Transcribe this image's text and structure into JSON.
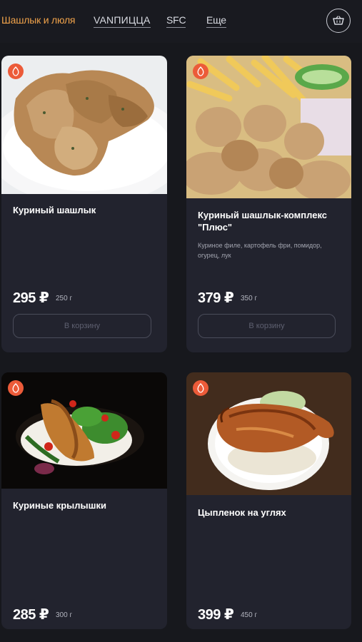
{
  "nav": {
    "items": [
      {
        "label": "Шашлык и люля"
      },
      {
        "label": "VANПИЦЦА"
      },
      {
        "label": "SFC"
      },
      {
        "label": "Еще"
      }
    ],
    "cart_icon": "basket-icon"
  },
  "products": [
    {
      "title": "Куриный шашлык",
      "description": "",
      "price": "295 ₽",
      "weight": "250 г",
      "button": "В корзину"
    },
    {
      "title": "Куриный шашлык-комплекс \"Плюс\"",
      "description": "Куриное филе, картофель фри, помидор, огурец, лук",
      "price": "379 ₽",
      "weight": "350 г",
      "button": "В корзину"
    },
    {
      "title": "Куриные крылышки",
      "description": "",
      "price": "285 ₽",
      "weight": "300 г",
      "button": ""
    },
    {
      "title": "Цыпленок на углях",
      "description": "",
      "price": "399 ₽",
      "weight": "450 г",
      "button": ""
    }
  ],
  "colors": {
    "accent": "#f0a24a",
    "badge": "#ec5b39",
    "card": "#22232e",
    "background": "#17181d"
  }
}
